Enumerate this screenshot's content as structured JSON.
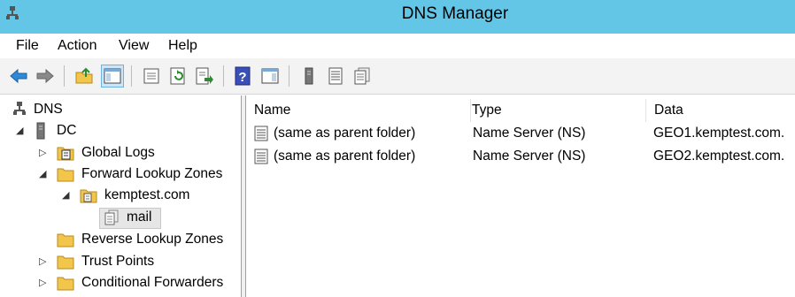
{
  "window": {
    "title": "DNS Manager"
  },
  "menu": [
    "File",
    "Action",
    "View",
    "Help"
  ],
  "toolbar": {
    "buttons": [
      "back-icon",
      "forward-icon",
      "up-folder-icon",
      "show-hide-tree-icon",
      "properties-icon",
      "refresh-icon",
      "export-list-icon",
      "help-icon",
      "show-hide-action-pane-icon",
      "server-icon",
      "record-list-icon",
      "record-pages-icon"
    ]
  },
  "tree": {
    "root": "DNS",
    "server": "DC",
    "global_logs": "Global Logs",
    "forward_zones": "Forward Lookup Zones",
    "zone": "kemptest.com",
    "subdomain": "mail",
    "reverse_zones": "Reverse Lookup Zones",
    "trust_points": "Trust Points",
    "cond_forwarders": "Conditional Forwarders"
  },
  "list": {
    "columns": [
      "Name",
      "Type",
      "Data"
    ],
    "rows": [
      {
        "name": "(same as parent folder)",
        "type": "Name Server (NS)",
        "data": "GEO1.kemptest.com."
      },
      {
        "name": "(same as parent folder)",
        "type": "Name Server (NS)",
        "data": "GEO2.kemptest.com."
      }
    ]
  },
  "colors": {
    "titlebar": "#63c6e6",
    "selection": "#e6e6e6",
    "toolbar": "#f3f3f3"
  }
}
